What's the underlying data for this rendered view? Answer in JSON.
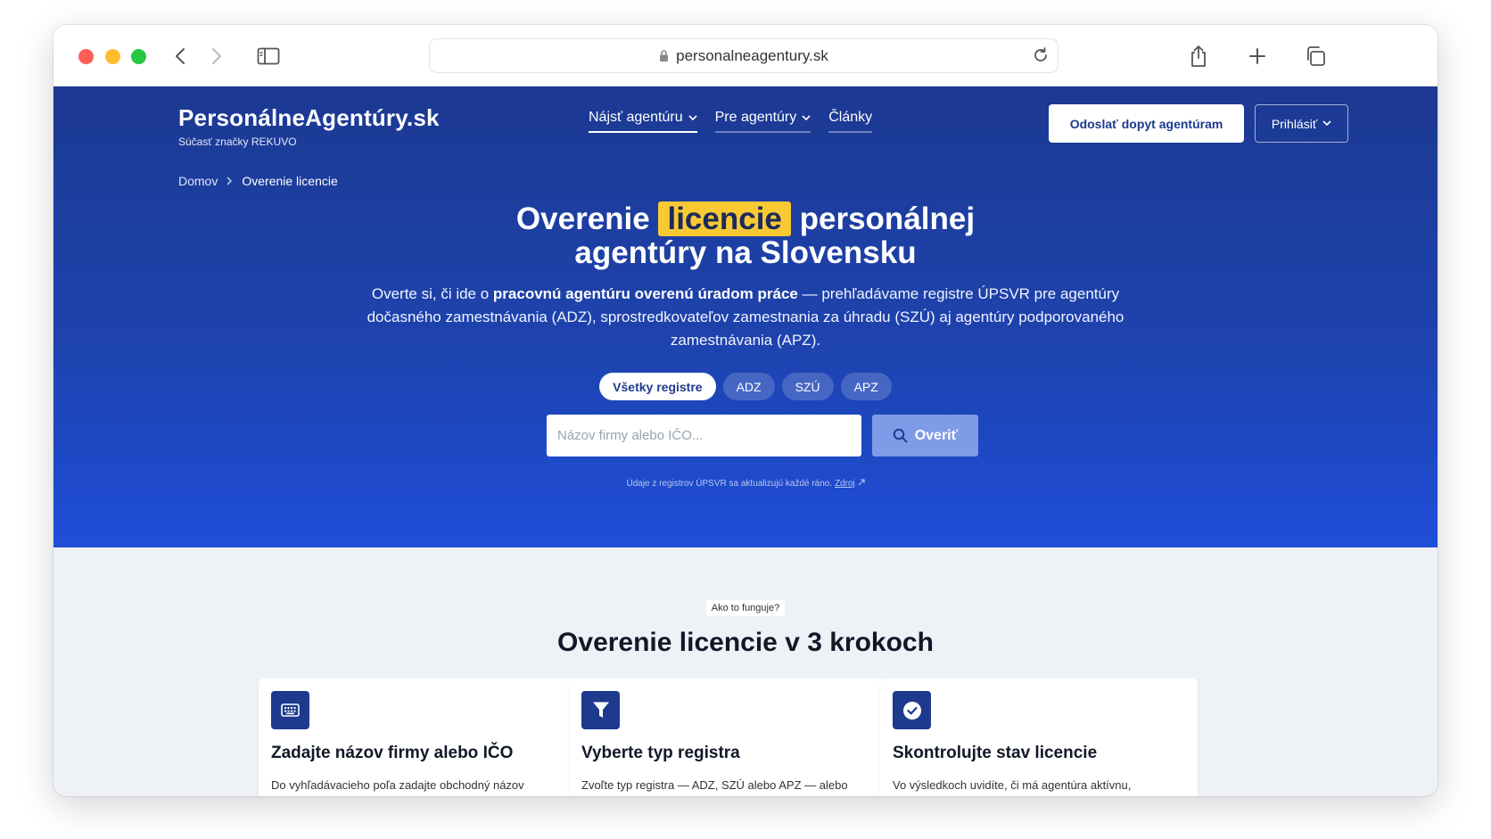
{
  "browser": {
    "url": "personalneagentury.sk"
  },
  "header": {
    "logo_name": "PersonálneAgentúry.sk",
    "logo_sub": "Súčasť značky REKUVO",
    "nav": [
      {
        "label": "Nájsť agentúru"
      },
      {
        "label": "Pre agentúry"
      },
      {
        "label": "Články"
      }
    ],
    "cta_label": "Odoslať dopyt agentúram",
    "login_label": "Prihlásiť"
  },
  "breadcrumb": {
    "home": "Domov",
    "current": "Overenie licencie"
  },
  "hero": {
    "title_before": "Overenie",
    "title_highlight": "licencie",
    "title_after": "personálnej",
    "title_line2": "agentúry na Slovensku",
    "desc_part1": "Overte si, či ide o ",
    "desc_bold": "pracovnú agentúru overenú úradom práce",
    "desc_part2": " — prehľadávame registre ÚPSVR pre agentúry dočasného zamestnávania (ADZ), sprostredkovateľov zamestnania za úhradu (SZÚ) aj agentúry podporovaného zamestnávania (APZ).",
    "filters": [
      "Všetky registre",
      "ADZ",
      "SZÚ",
      "APZ"
    ],
    "search_placeholder": "Názov firmy alebo IČO...",
    "search_button": "Overiť",
    "note_text": "Údaje z registrov ÚPSVR sa aktualizujú každé ráno.",
    "note_link": "Zdroj"
  },
  "steps": {
    "label": "Ako to funguje?",
    "title": "Overenie licencie v 3 krokoch",
    "cards": [
      {
        "icon": "keyboard-icon",
        "title": "Zadajte názov firmy alebo IČO",
        "text": "Do vyhľadávacieho poľa zadajte obchodný názov"
      },
      {
        "icon": "filter-icon",
        "title": "Vyberte typ registra",
        "text": "Zvoľte typ registra — ADZ, SZÚ alebo APZ — alebo"
      },
      {
        "icon": "check-circle-icon",
        "title": "Skontrolujte stav licencie",
        "text": "Vo výsledkoch uvidíte, či má agentúra aktívnu,"
      }
    ]
  },
  "colors": {
    "hero_top": "#1c3992",
    "hero_bottom": "#1f4ed8",
    "highlight": "#f9c934",
    "search_button": "#7f9ae7",
    "icon_bg": "#1d3a8f"
  }
}
